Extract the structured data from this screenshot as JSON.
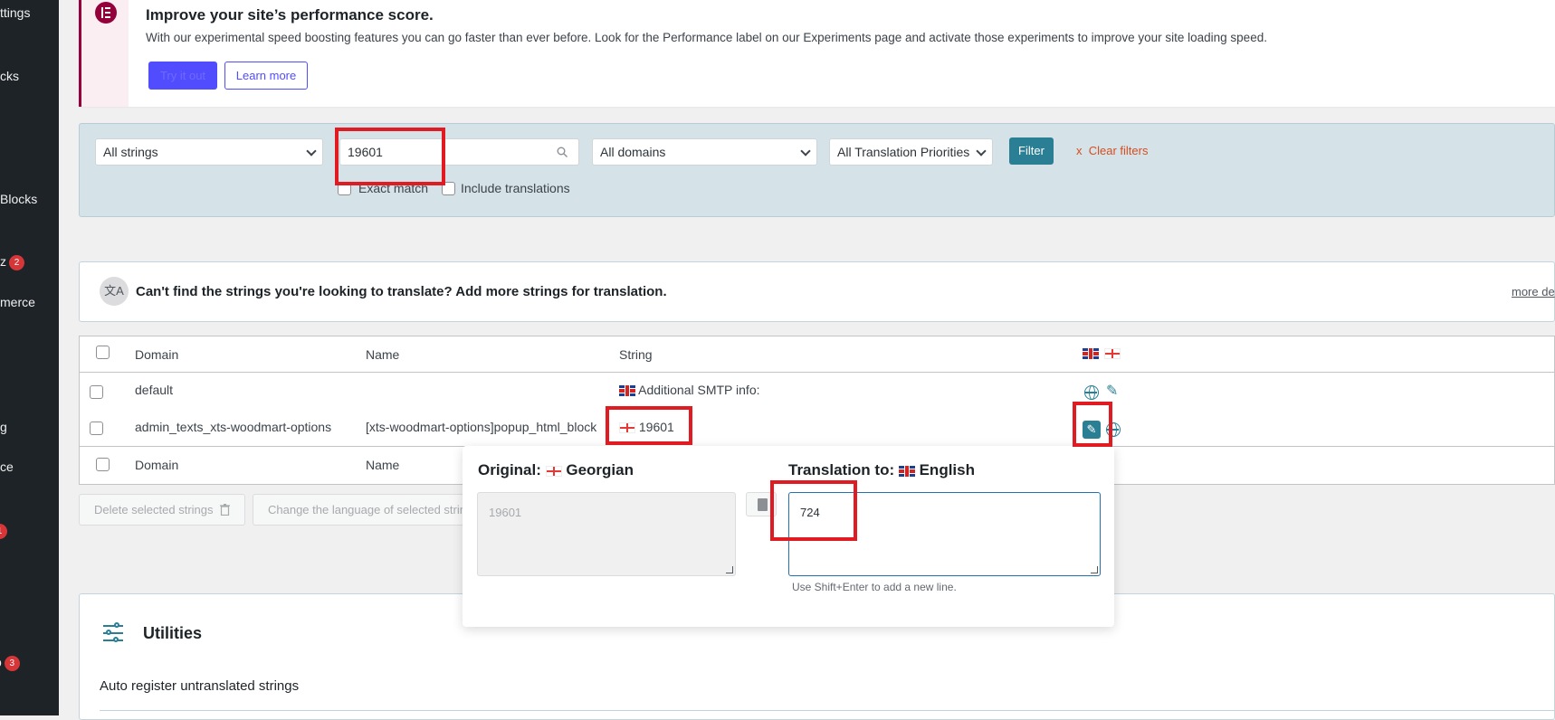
{
  "sidebar": {
    "items": [
      {
        "label": "ttings"
      },
      {
        "label": "cks"
      },
      {
        "label": "Blocks"
      },
      {
        "label": "z",
        "badge": "2"
      },
      {
        "label": "merce"
      },
      {
        "label": "g"
      },
      {
        "label": "ce"
      },
      {
        "label": "",
        "badge": "1"
      },
      {
        "label": "o",
        "badge": "3"
      }
    ]
  },
  "notice": {
    "title": "Improve your site’s performance score.",
    "text": "With our experimental speed boosting features you can go faster than ever before. Look for the Performance label on our Experiments page and activate those experiments to improve your site loading speed.",
    "primary_button": "Try it out",
    "secondary_button": "Learn more"
  },
  "filters": {
    "strings_select": "All strings",
    "search_value": "19601",
    "domains_select": "All domains",
    "priorities_select": "All Translation Priorities",
    "exact_match_label": "Exact match",
    "include_translations_label": "Include translations",
    "filter_button": "Filter",
    "clear_filters_x": "x",
    "clear_filters_label": "Clear filters"
  },
  "infobox": {
    "icon_text": "文A",
    "text": "Can't find the strings you're looking to translate? Add more strings for translation.",
    "more_link": "more de"
  },
  "table": {
    "headers": {
      "domain": "Domain",
      "name": "Name",
      "string": "String"
    },
    "rows": [
      {
        "domain": "default",
        "name": "",
        "string": "Additional SMTP info:"
      },
      {
        "domain": "admin_texts_xts-woodmart-options",
        "name": "[xts-woodmart-options]popup_html_block",
        "string": "19601"
      }
    ],
    "footer": {
      "domain": "Domain",
      "name": "Name"
    }
  },
  "actions": {
    "delete_selected": "Delete selected strings",
    "change_language": "Change the language of selected strin"
  },
  "popup": {
    "original_label": "Original:",
    "original_language": "Georgian",
    "original_value": "19601",
    "translation_label": "Translation to:",
    "translation_language": "English",
    "translation_value": "724",
    "hint": "Use Shift+Enter to add a new line."
  },
  "utilities": {
    "title": "Utilities",
    "auto_register": "Auto register untranslated strings"
  },
  "colors": {
    "sidebar": "#1d2327",
    "accent": "#2b7f95",
    "elementor": "#93003c",
    "primary_button": "#524cff",
    "highlight": "#e11b22",
    "clear_link": "#d54e21"
  }
}
